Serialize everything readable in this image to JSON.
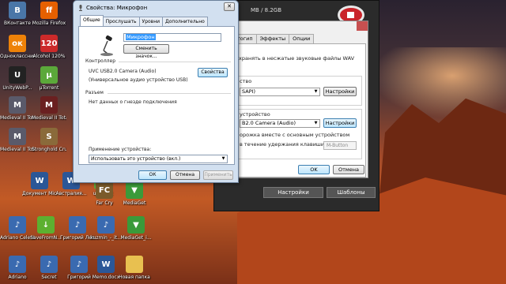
{
  "desktop_icons": [
    {
      "label": "ВКонтакте",
      "icon": "vk-icon",
      "color": "#4a76a8",
      "glyph": "В"
    },
    {
      "label": "Mozilla Firefox",
      "icon": "firefox-icon",
      "color": "#e66000",
      "glyph": "ff"
    },
    {
      "label": "Одноклассники",
      "icon": "ok-icon",
      "color": "#ee8208",
      "glyph": "ок"
    },
    {
      "label": "Alcohol 120%",
      "icon": "alcohol-icon",
      "color": "#cc2a2a",
      "glyph": "120"
    },
    {
      "label": "UnityWebP...",
      "icon": "unity-icon",
      "color": "#222222",
      "glyph": "U"
    },
    {
      "label": "µTorrent",
      "icon": "utorrent-icon",
      "color": "#5ba83a",
      "glyph": "µ"
    },
    {
      "label": "Medieval II Total War...",
      "icon": "medieval-icon",
      "color": "#5a5a6a",
      "glyph": "M"
    },
    {
      "label": "Medieval II Total War",
      "icon": "medieval-icon",
      "color": "#6a2020",
      "glyph": "M"
    },
    {
      "label": "Medieval II Total War",
      "icon": "medieval-icon",
      "color": "#5a5a6a",
      "glyph": "M"
    },
    {
      "label": "Stronghold Crusader",
      "icon": "stronghold-icon",
      "color": "#8a6a3a",
      "glyph": "S"
    },
    {
      "label": "Документ Microsoft...",
      "icon": "document-icon",
      "color": "#2b5797",
      "glyph": "W"
    },
    {
      "label": "Австралия...",
      "icon": "document-icon",
      "color": "#2b5797",
      "glyph": "W"
    },
    {
      "label": "uTorrent",
      "icon": "utorrent-icon",
      "color": "#5ba83a",
      "glyph": "µ"
    },
    {
      "label": "Far Cry",
      "icon": "farcry-icon",
      "color": "#7a5a2a",
      "glyph": "FC"
    },
    {
      "label": "MediaGet",
      "icon": "mediaget-icon",
      "color": "#3a9a3a",
      "glyph": "▼"
    },
    {
      "label": "Adriano Celentano -...",
      "icon": "mp3-icon",
      "color": "#3a6ab0",
      "glyph": "♪"
    },
    {
      "label": "SaveFromN...",
      "icon": "savefrom-icon",
      "color": "#5cb030",
      "glyph": "↓"
    },
    {
      "label": "Григорий Лепс - 08...",
      "icon": "mp3-icon",
      "color": "#3a6ab0",
      "glyph": "♪"
    },
    {
      "label": "kuzmin_-_it...",
      "icon": "mp3-icon",
      "color": "#3a6ab0",
      "glyph": "♪"
    },
    {
      "label": "MediaGet_i...",
      "icon": "mediaget-icon",
      "color": "#3a9a3a",
      "glyph": "▼"
    },
    {
      "label": "Adriano",
      "icon": "mp3-icon",
      "color": "#3a6ab0",
      "glyph": "♪"
    },
    {
      "label": "Secret",
      "icon": "mp3-icon",
      "color": "#3a6ab0",
      "glyph": "♪"
    },
    {
      "label": "Григорий",
      "icon": "mp3-icon",
      "color": "#3a6ab0",
      "glyph": "♪"
    },
    {
      "label": "Memo.docx",
      "icon": "document-icon",
      "color": "#2b5797",
      "glyph": "W"
    },
    {
      "label": "Новая папка",
      "icon": "folder-icon",
      "color": "#e8c050",
      "glyph": ""
    }
  ],
  "dark_app": {
    "size_text": "MB / 8.2GB",
    "settings_label": "Настройки",
    "templates_label": "Шаблоны"
  },
  "recorder_dialog": {
    "tabs": [
      "отогип",
      "Эффекты",
      "Опции"
    ],
    "save_text": "хранять в несжатые звуковые файлы WAV",
    "line_device_label": "ство",
    "device1_value": "SAPI)",
    "device1_button": "Настройки",
    "device2_label": "устройство",
    "device2_value": "B2.0 Camera (Audio)",
    "device2_button": "Настройки",
    "track_text": "орожка вместе с основным устройством",
    "hold_text": "в течение удержания клавиши",
    "hold_key": "M-Button",
    "ok_label": "OK",
    "cancel_label": "Отмена"
  },
  "properties_dialog": {
    "title": "Свойства: Микрофон",
    "close_glyph": "✕",
    "tabs": [
      "Общие",
      "Прослушать",
      "Уровни",
      "Дополнительно"
    ],
    "name_value": "Микрофон",
    "change_icon_button": "Сменить значок...",
    "controller_heading": "Контроллер",
    "controller_name": "UVC USB2.0 Camera (Audio)",
    "controller_desc": "(Универсальное аудио устройство USB)",
    "controller_props_button": "Свойства",
    "jack_heading": "Разъем",
    "jack_text": "Нет данных о гнезде подключения",
    "usage_label": "Применение устройства:",
    "usage_value": "Использовать это устройство (вкл.)",
    "ok_label": "ОК",
    "cancel_label": "Отмена",
    "apply_label": "Применить"
  }
}
